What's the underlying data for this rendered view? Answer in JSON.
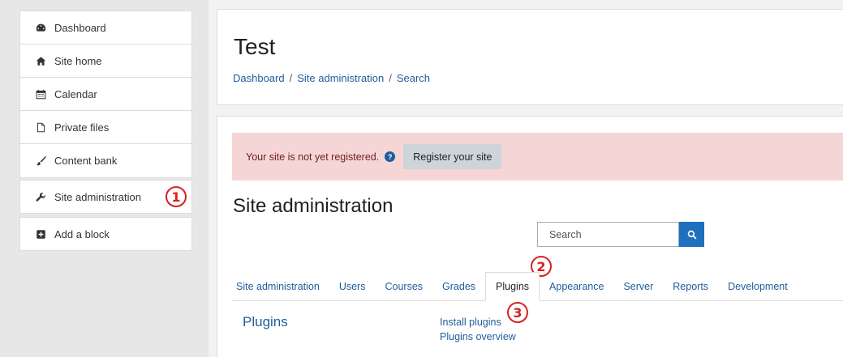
{
  "sidebar": {
    "items": [
      {
        "label": "Dashboard",
        "icon": "tachometer-icon"
      },
      {
        "label": "Site home",
        "icon": "home-icon"
      },
      {
        "label": "Calendar",
        "icon": "calendar-icon"
      },
      {
        "label": "Private files",
        "icon": "file-icon"
      },
      {
        "label": "Content bank",
        "icon": "paintbrush-icon"
      }
    ],
    "site_admin": {
      "label": "Site administration",
      "icon": "wrench-icon"
    },
    "add_block": {
      "label": "Add a block",
      "icon": "plus-square-icon"
    }
  },
  "header": {
    "title": "Test",
    "breadcrumb": [
      "Dashboard",
      "Site administration",
      "Search"
    ],
    "breadcrumb_sep": "/"
  },
  "alert": {
    "text": "Your site is not yet registered.",
    "button": "Register your site"
  },
  "main": {
    "title": "Site administration",
    "search_placeholder": "Search",
    "tabs": [
      "Site administration",
      "Users",
      "Courses",
      "Grades",
      "Plugins",
      "Appearance",
      "Server",
      "Reports",
      "Development"
    ],
    "active_tab": "Plugins",
    "section_label": "Plugins",
    "links": [
      "Install plugins",
      "Plugins overview"
    ]
  },
  "markers": [
    "1",
    "2",
    "3"
  ],
  "colors": {
    "link": "#1f5d9c",
    "alert_bg": "#f5d5d5",
    "marker": "#d62020",
    "search_btn": "#1f6fbf"
  }
}
